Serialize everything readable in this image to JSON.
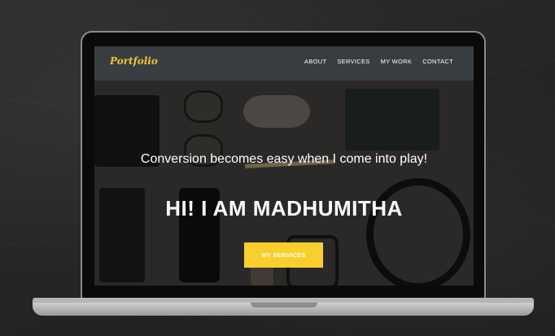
{
  "site": {
    "logo": "Portfolio",
    "nav": [
      "ABOUT",
      "SERVICES",
      "MY WORK",
      "CONTACT"
    ],
    "tagline": "Conversion becomes easy when I come into play!",
    "headline": "HI! I AM MADHUMITHA",
    "cta_label": "MY SERVICES"
  },
  "colors": {
    "accent": "#f9cf2d",
    "logo": "#f4c430",
    "nav_bg": "#383d42",
    "page_bg": "#262626"
  }
}
